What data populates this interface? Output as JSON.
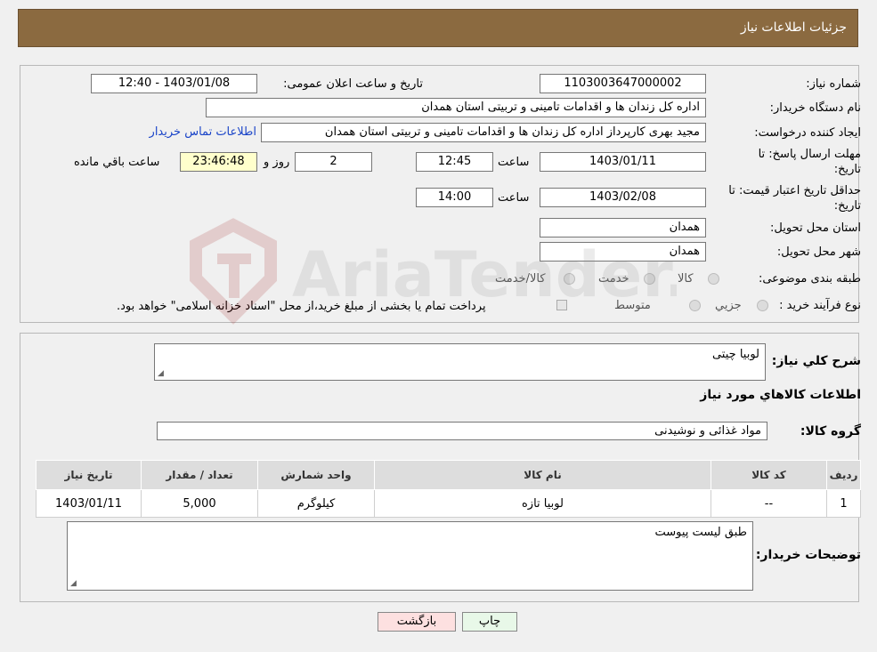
{
  "header": {
    "title": "جزئیات اطلاعات نیاز"
  },
  "form": {
    "need_number_label": "شماره نیاز:",
    "need_number": "1103003647000002",
    "announce_label": "تاریخ و ساعت اعلان عمومی:",
    "announce_value": "1403/01/08 - 12:40",
    "buyer_label": "نام دستگاه خریدار:",
    "buyer_value": "اداره کل زندان ها و اقدامات تامینی و تربیتی استان همدان",
    "creator_label": "ایجاد کننده درخواست:",
    "creator_value": "مجید بهری کارپرداز اداره کل زندان ها و اقدامات تامینی و تربیتی استان همدان",
    "contact_link": "اطلاعات تماس خریدار",
    "deadline_label_1": "مهلت ارسال پاسخ: تا",
    "deadline_label_2": "تاریخ:",
    "deadline_date": "1403/01/11",
    "time_label": "ساعت",
    "deadline_time": "12:45",
    "days_value": "2",
    "days_label": "روز و",
    "remaining_time": "23:46:48",
    "remaining_label": "ساعت باقي مانده",
    "validity_label_1": "حداقل تاریخ اعتبار قیمت: تا",
    "validity_label_2": "تاریخ:",
    "validity_date": "1403/02/08",
    "validity_time": "14:00",
    "province_label": "استان محل تحویل:",
    "province_value": "همدان",
    "city_label": "شهر محل تحویل:",
    "city_value": "همدان",
    "category_label": "طبقه بندی موضوعی:",
    "category_options": [
      "کالا",
      "خدمت",
      "کالا/خدمت"
    ],
    "process_label": "نوع فرآیند خرید :",
    "process_options": [
      "جزيي",
      "متوسط"
    ],
    "payment_note": "پرداخت تمام یا بخشی از مبلغ خرید،از محل \"اسناد خزانه اسلامی\" خواهد بود."
  },
  "details": {
    "general_desc_label": "شرح کلي نياز:",
    "general_desc_value": "لوبیا چیتی",
    "items_section_title": "اطلاعات کالاهاي مورد نياز",
    "group_label": "گروه کالا:",
    "group_value": "مواد غذائی و نوشیدنی",
    "table": {
      "headers": [
        "رديف",
        "کد کالا",
        "نام کالا",
        "واحد شمارش",
        "تعداد / مقدار",
        "تاريخ نياز"
      ],
      "rows": [
        [
          "1",
          "--",
          "لوبیا تازه",
          "کیلوگرم",
          "5,000",
          "1403/01/11"
        ]
      ]
    },
    "buyer_notes_label": "توضيحات خريدار:",
    "buyer_notes_value": "طبق لیست پیوست"
  },
  "buttons": {
    "print": "چاپ",
    "back": "بازگشت"
  },
  "watermark": {
    "text": "AriaTender.neT"
  },
  "colors": {
    "header_bg": "#8b6a40",
    "link": "#1a44c8",
    "remaining_bg": "#ffffcc",
    "back_bg": "#fde0e0",
    "print_bg": "#e8f8e8"
  }
}
